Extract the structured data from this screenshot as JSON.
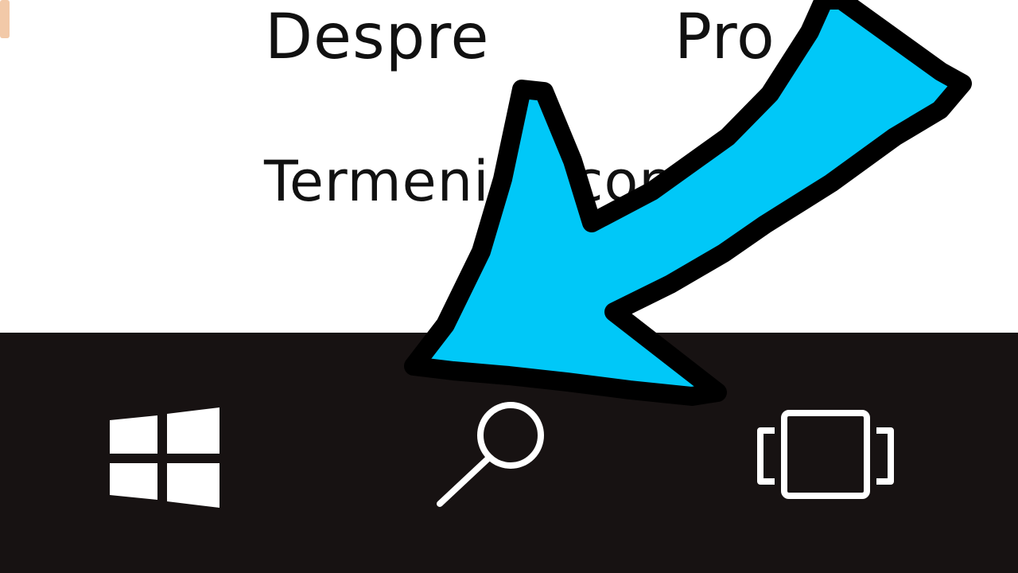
{
  "page": {
    "links": {
      "about": "Despre",
      "partial_right": "Pro",
      "terms": "Termeni și condiții"
    }
  },
  "taskbar": {
    "buttons": [
      {
        "name": "start",
        "icon": "windows-logo-icon"
      },
      {
        "name": "search",
        "icon": "search-icon"
      },
      {
        "name": "task-view",
        "icon": "task-view-icon"
      }
    ]
  },
  "annotation": {
    "arrow_color": "#00c8f8",
    "arrow_outline": "#000000",
    "points_to": "search-button"
  },
  "colors": {
    "page_background": "#ffffff",
    "taskbar_background": "#171212",
    "icon_color": "#ffffff",
    "link_text": "#111111"
  }
}
